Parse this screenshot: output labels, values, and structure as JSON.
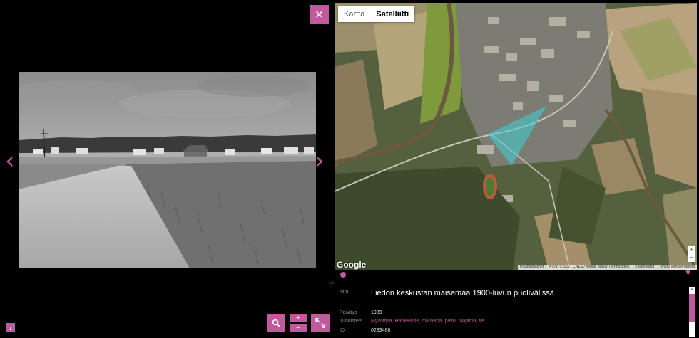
{
  "viewer": {
    "close_icon": "×",
    "prev_icon": "‹",
    "next_icon": "›",
    "zoom_in_label": "+",
    "zoom_out_label": "−",
    "download_icon": "↓"
  },
  "map": {
    "tabs": [
      {
        "label": "Kartta",
        "active": false
      },
      {
        "label": "Satelliitti",
        "active": true
      }
    ],
    "google_label": "Google",
    "attribution": [
      "Pikanäppäimet",
      "Kuvat ©2022 , CNES / Airbus, Maxar Technologies",
      "Käyttöehdot",
      "Ilmoita karttavirheestä"
    ],
    "zoom_in": "+",
    "zoom_out": "−"
  },
  "info": {
    "name_label": "Nimi",
    "name_value": "Liedon keskustan maisemaa 1900-luvun puolivälissä",
    "date_label": "Päiväys",
    "date_value": "1939",
    "tags_label": "Tunnisteet",
    "tags_value": "Myvättylä, Hämeentie, maisema, pelto, taajama, tie",
    "id_label": "ID",
    "id_value": "0233488"
  },
  "colors": {
    "accent": "#c05a9c",
    "background": "#000000"
  }
}
